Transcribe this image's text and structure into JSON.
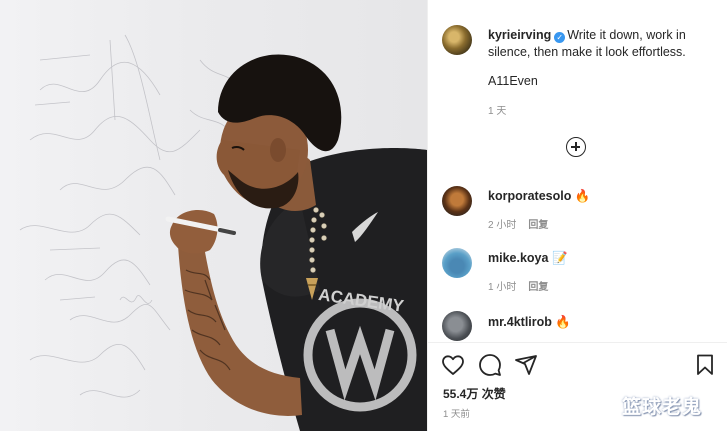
{
  "post": {
    "author": "kyrieirving",
    "verified": true,
    "caption_text": "Write it down, work in silence, then make it look effortless.",
    "hashtag": "A11Even",
    "caption_time": "1 天",
    "shirt_text": "ACADEMY"
  },
  "comments": [
    {
      "username": "korporatesolo",
      "emoji": "🔥",
      "time": "2 小时",
      "reply_label": "回复"
    },
    {
      "username": "mike.koya",
      "emoji": "📝",
      "time": "1 小时",
      "reply_label": "回复"
    },
    {
      "username": "mr.4ktlirob",
      "emoji": "🔥"
    }
  ],
  "actions": {
    "icons": [
      "heart-icon",
      "comment-icon",
      "share-icon",
      "bookmark-icon"
    ],
    "likes": "55.4万 次赞",
    "posted_ago": "1 天前"
  },
  "watermark": "篮球老鬼",
  "colors": {
    "text": "#262626",
    "secondary": "#8e8e8e",
    "verified": "#3897f0",
    "flame": "#f57c00",
    "divider": "#efefef"
  }
}
